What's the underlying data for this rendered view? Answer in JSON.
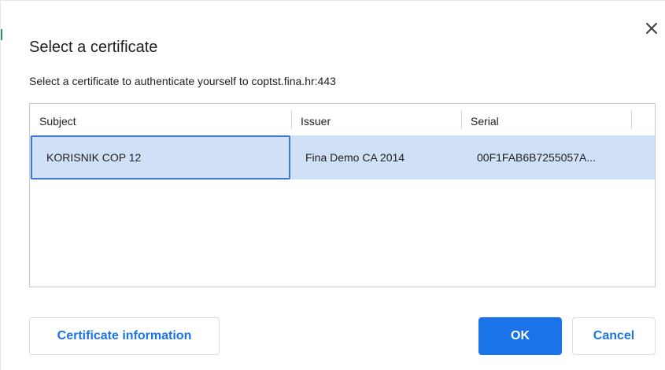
{
  "dialog": {
    "title": "Select a certificate",
    "description": "Select a certificate to authenticate yourself to coptst.fina.hr:443",
    "close_icon": "close-icon"
  },
  "table": {
    "columns": [
      "Subject",
      "Issuer",
      "Serial"
    ],
    "rows": [
      {
        "subject": "KORISNIK COP 12",
        "issuer": "Fina Demo CA 2014",
        "serial": "00F1FAB6B7255057A..."
      }
    ],
    "selected_row_color": "#cfe0f7",
    "focus_border_color": "#3b7bd8"
  },
  "buttons": {
    "info_label": "Certificate information",
    "ok_label": "OK",
    "cancel_label": "Cancel"
  },
  "colors": {
    "accent": "#1a73e8",
    "text": "#202124",
    "border": "#c8c8c8"
  }
}
